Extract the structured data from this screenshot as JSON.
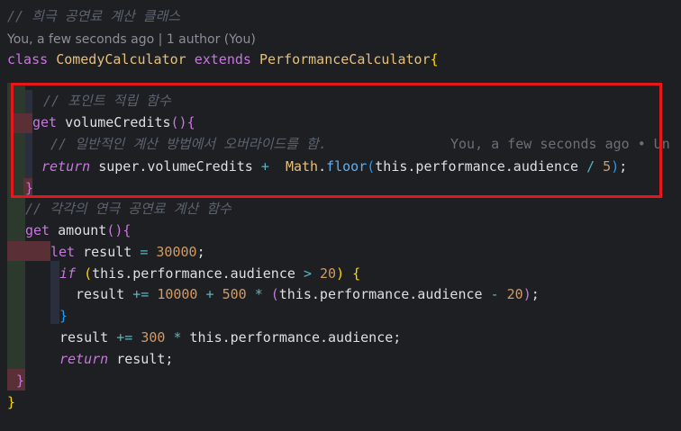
{
  "comment_top": "// 희극 공연료 계산 클래스",
  "git_blame_header": "You, a few seconds ago | 1 author (You)",
  "class_line": {
    "kw_class": "class",
    "name": "ComedyCalculator",
    "kw_extends": "extends",
    "parent": "PerformanceCalculator",
    "brace": "{"
  },
  "comment_points": "// 포인트 적립 함수",
  "volume_get": {
    "kw": "get",
    "name": "volumeCredits",
    "parens": "()",
    "brace": "{"
  },
  "comment_override": "// 일반적인 계산 방법에서 오버라이드를 함.",
  "inline_blame": "You, a few seconds ago • Un",
  "return_line": {
    "kw": "return",
    "text1": "super.volumeCredits",
    "plus": "+",
    "math": "Math",
    "floor": "floor",
    "open": "(",
    "this": "this",
    "path": ".performance.audience",
    "div": "/",
    "num": "5",
    "close": ")",
    "semi": ";"
  },
  "close_brace_1": "}",
  "comment_amount": "// 각각의 연극 공연료 계산 함수",
  "amount_get": {
    "kw": "get",
    "name": "amount",
    "parens": "()",
    "brace": "{"
  },
  "let_line": {
    "kw": "let",
    "name": "result",
    "eq": "=",
    "num": "30000",
    "semi": ";"
  },
  "if_line": {
    "kw": "if",
    "open": "(",
    "this": "this",
    "path": ".performance.audience",
    "gt": ">",
    "num": "20",
    "close": ")",
    "brace": "{"
  },
  "result_add_1": {
    "name": "result",
    "op": "+=",
    "n1": "10000",
    "plus": "+",
    "n2": "500",
    "mul": "*",
    "open": "(",
    "this": "this",
    "path": ".performance.audience",
    "minus": "-",
    "n3": "20",
    "close": ")",
    "semi": ";"
  },
  "close_brace_if": "}",
  "result_add_2": {
    "name": "result",
    "op": "+=",
    "n1": "300",
    "mul": "*",
    "this": "this",
    "path": ".performance.audience",
    "semi": ";"
  },
  "return_result": {
    "kw": "return",
    "name": "result",
    "semi": ";"
  },
  "close_brace_2": "}",
  "close_brace_class": "}"
}
